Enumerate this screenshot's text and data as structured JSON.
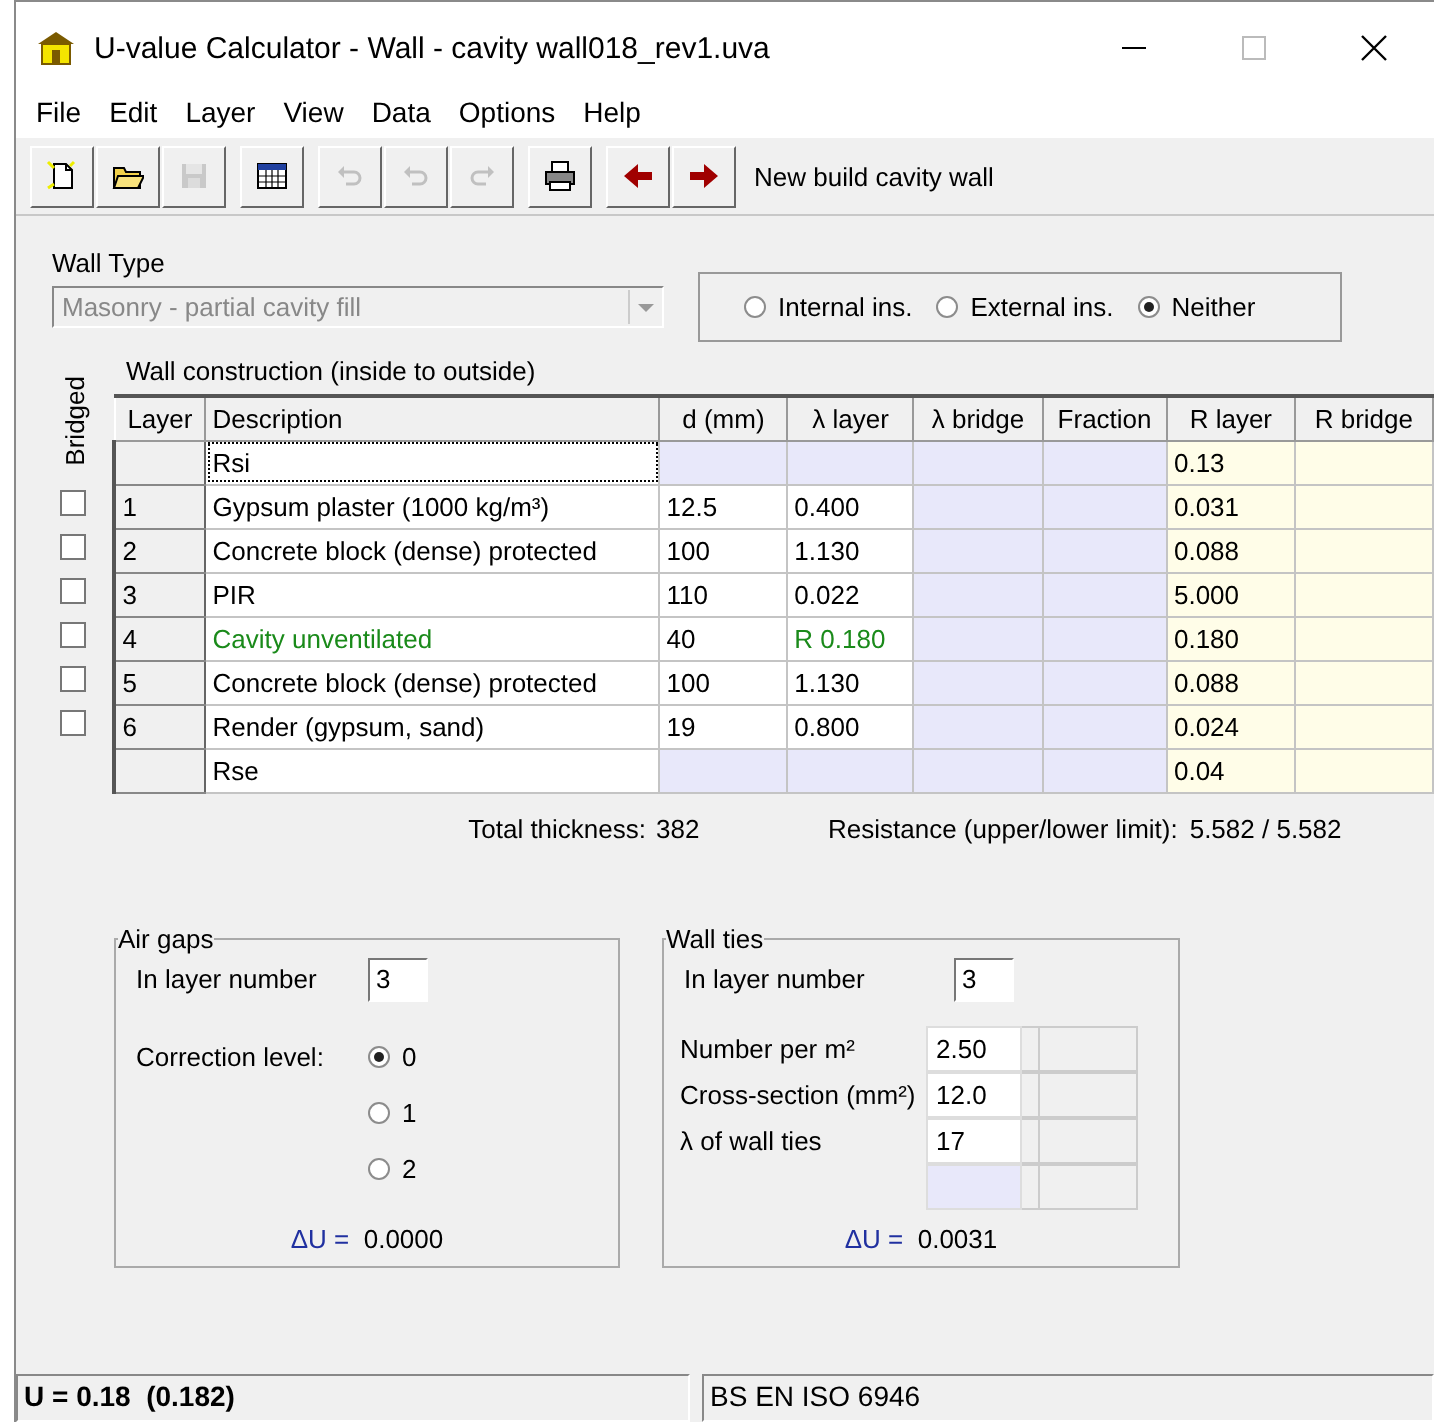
{
  "window": {
    "title": "U-value Calculator - Wall - cavity wall018_rev1.uva"
  },
  "menu": [
    "File",
    "Edit",
    "Layer",
    "View",
    "Data",
    "Options",
    "Help"
  ],
  "toolbar": {
    "groups": [
      [
        {
          "kind": "new",
          "disabled": false
        },
        {
          "kind": "open",
          "disabled": false
        },
        {
          "kind": "save",
          "disabled": true
        }
      ],
      [
        {
          "kind": "table",
          "disabled": false
        }
      ],
      [
        {
          "kind": "undo",
          "disabled": true
        },
        {
          "kind": "undo",
          "disabled": true
        },
        {
          "kind": "redo",
          "disabled": true
        }
      ],
      [
        {
          "kind": "print",
          "disabled": false
        }
      ],
      [
        {
          "kind": "back",
          "disabled": false
        },
        {
          "kind": "forward",
          "disabled": false
        }
      ]
    ],
    "label": "New build cavity wall"
  },
  "wall_type": {
    "label": "Wall Type",
    "value": "Masonry - partial cavity fill",
    "disabled": true
  },
  "insulation_options": [
    {
      "label": "Internal ins.",
      "selected": false
    },
    {
      "label": "External ins.",
      "selected": false
    },
    {
      "label": "Neither",
      "selected": true
    }
  ],
  "construction": {
    "title": "Wall construction (inside to outside)",
    "bridged_label": "Bridged",
    "columns": [
      "Layer",
      "Description",
      "d (mm)",
      "λ layer",
      "λ bridge",
      "Fraction",
      "R layer",
      "R bridge"
    ],
    "rows": [
      {
        "kind": "surface",
        "description": "Rsi",
        "r_layer": "0.13"
      },
      {
        "kind": "material",
        "bridged": false,
        "layer": "1",
        "description": "Gypsum plaster (1000 kg/m³)",
        "d": "12.5",
        "lambda": "0.400",
        "r_layer": "0.031"
      },
      {
        "kind": "material",
        "bridged": false,
        "layer": "2",
        "description": "Concrete block (dense) protected",
        "d": "100",
        "lambda": "1.130",
        "r_layer": "0.088"
      },
      {
        "kind": "material",
        "bridged": false,
        "layer": "3",
        "description": "PIR",
        "d": "110",
        "lambda": "0.022",
        "r_layer": "5.000"
      },
      {
        "kind": "cavity",
        "bridged": false,
        "layer": "4",
        "description": "Cavity unventilated",
        "d": "40",
        "lambda": "R 0.180",
        "r_layer": "0.180"
      },
      {
        "kind": "material",
        "bridged": false,
        "layer": "5",
        "description": "Concrete block (dense) protected",
        "d": "100",
        "lambda": "1.130",
        "r_layer": "0.088"
      },
      {
        "kind": "material",
        "bridged": false,
        "layer": "6",
        "description": "Render (gypsum, sand)",
        "d": "19",
        "lambda": "0.800",
        "r_layer": "0.024"
      },
      {
        "kind": "surface",
        "description": "Rse",
        "r_layer": "0.04"
      }
    ]
  },
  "totals": {
    "thickness_label": "Total thickness:",
    "thickness": "382",
    "resistance_label": "Resistance (upper/lower limit):",
    "resistance": "5.582 / 5.582"
  },
  "air_gaps": {
    "title": "Air gaps",
    "layer_label": "In layer number",
    "layer": "3",
    "correction_label": "Correction level:",
    "levels": [
      {
        "label": "0",
        "selected": true
      },
      {
        "label": "1",
        "selected": false
      },
      {
        "label": "2",
        "selected": false
      }
    ],
    "delta_label": "ΔU =",
    "delta_u": "0.0000"
  },
  "wall_ties": {
    "title": "Wall ties",
    "layer_label": "In layer number",
    "layer": "3",
    "rows": [
      {
        "label": "Number per m²",
        "value": "2.50"
      },
      {
        "label": "Cross-section (mm²)",
        "value": "12.0"
      },
      {
        "label": "λ of wall ties",
        "value": "17"
      }
    ],
    "delta_label": "ΔU =",
    "delta_u": "0.0031"
  },
  "status_bar": [
    {
      "text": "U = 0.18  (0.182)",
      "bold": true
    },
    {
      "text": "BS EN ISO 6946",
      "bold": false
    }
  ]
}
